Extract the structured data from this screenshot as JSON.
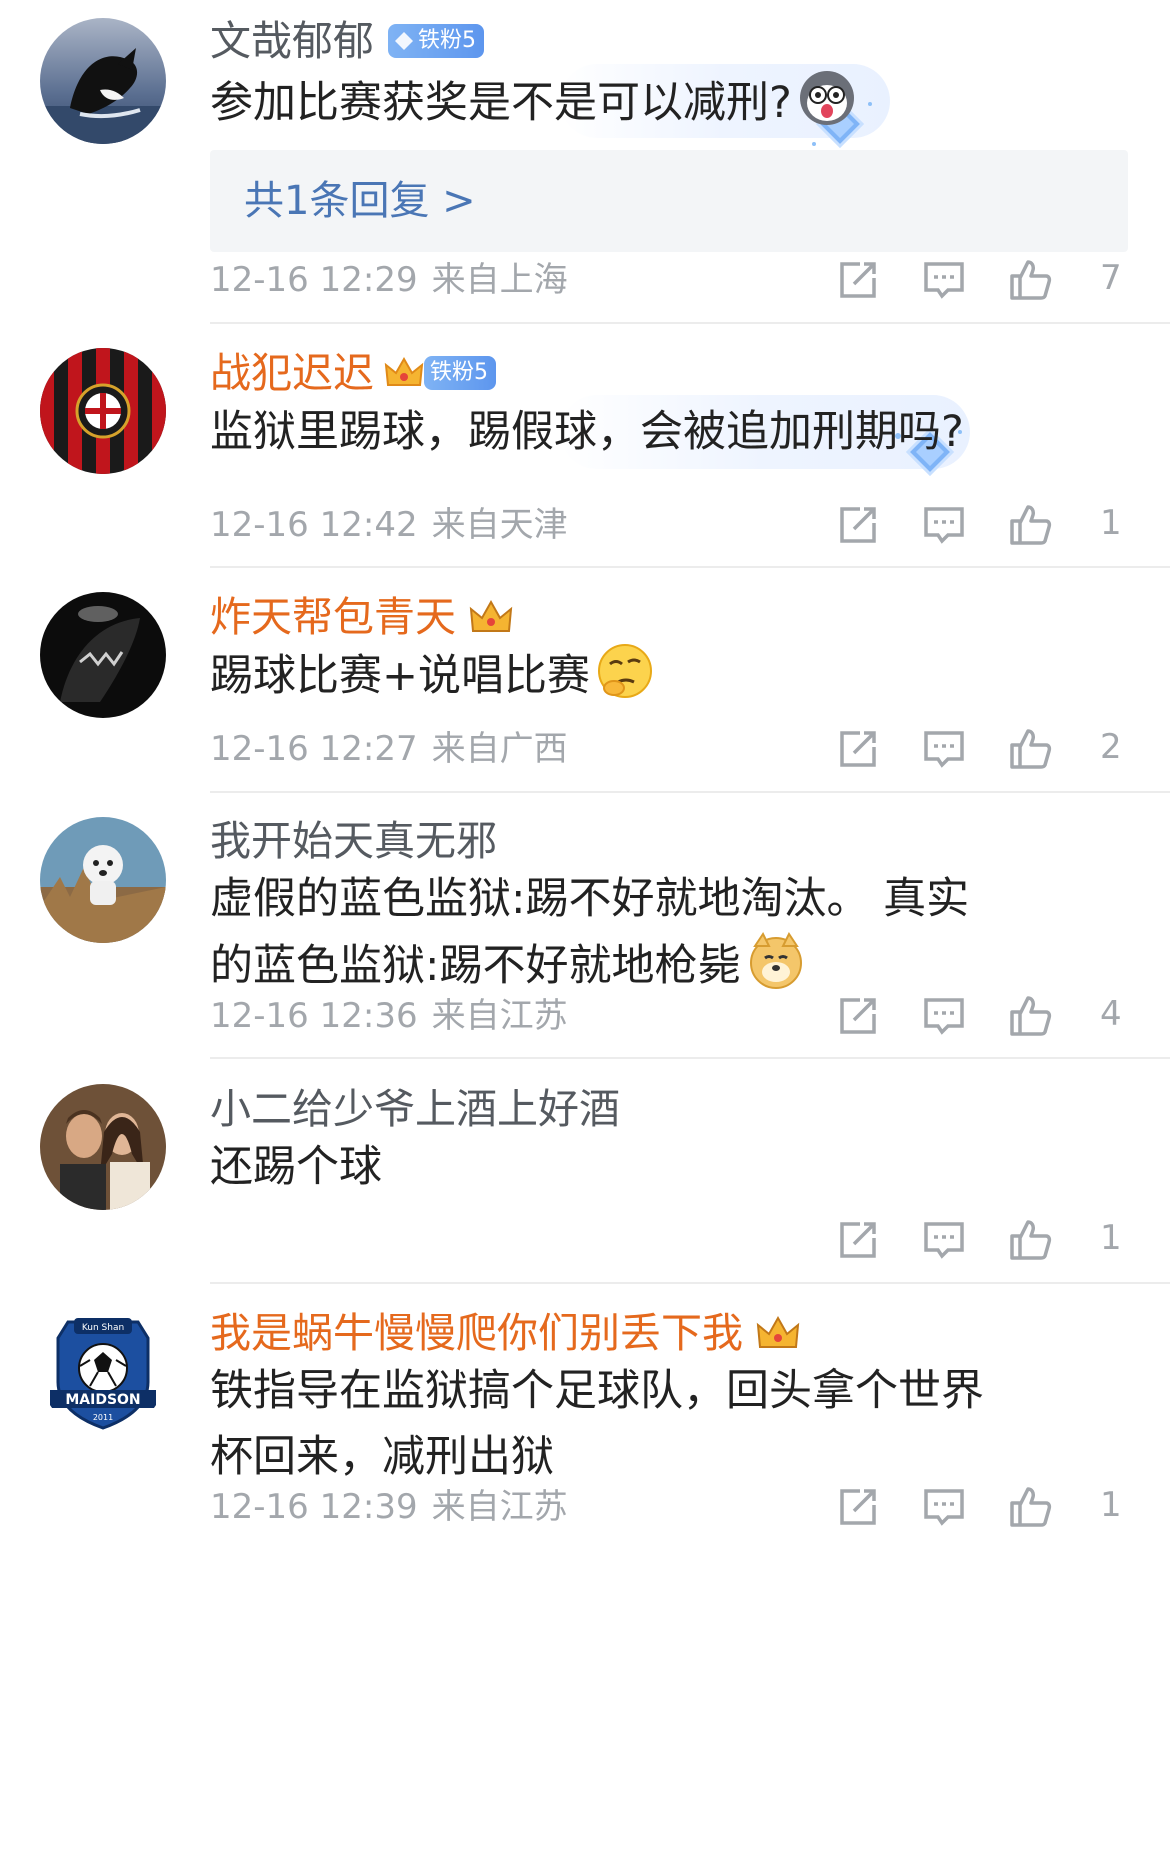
{
  "comments": [
    {
      "username": "文哉郁郁",
      "name_color": "gray",
      "badge": "铁粉5",
      "text": "参加比赛获奖是不是可以减刑?",
      "emoji": "shocked-husky-emoji",
      "reply_link": "共1条回复 >",
      "date": "12-16 12:29",
      "location": "来自上海",
      "likes": "7",
      "avatar": "orca-avatar"
    },
    {
      "username": "战犯迟迟",
      "name_color": "orange",
      "badge": "铁粉5",
      "text": "监狱里踢球，踢假球，会被追加刑期吗?",
      "date": "12-16 12:42",
      "location": "来自天津",
      "likes": "1",
      "avatar": "ac-milan-avatar"
    },
    {
      "username": "炸天帮包青天",
      "name_color": "orange",
      "text": "踢球比赛+说唱比赛",
      "emoji": "thinking-face-emoji",
      "date": "12-16 12:27",
      "location": "来自广西",
      "likes": "2",
      "avatar": "dark-creature-avatar"
    },
    {
      "username": "我开始天真无邪",
      "name_color": "gray",
      "text": "虚假的蓝色监狱:踢不好就地淘汰。 真实的蓝色监狱:踢不好就地枪毙",
      "emoji": "doge-emoji",
      "date": "12-16 12:36",
      "location": "来自江苏",
      "likes": "4",
      "avatar": "dog-city-avatar"
    },
    {
      "username": "小二给少爷上酒上好酒",
      "name_color": "gray",
      "text": "还踢个球",
      "date": "",
      "location": "",
      "likes": "1",
      "avatar": "couple-avatar"
    },
    {
      "username": "我是蜗牛慢慢爬你们别丢下我",
      "name_color": "orange",
      "text": "铁指导在监狱搞个足球队，回头拿个世界杯回来，减刑出狱",
      "date": "12-16 12:39",
      "location": "来自江苏",
      "likes": "1",
      "avatar": "maidson-badge-avatar",
      "avatar_text": {
        "top": "Kun Shan",
        "main": "MAIDSON",
        "year": "2011"
      }
    }
  ],
  "colors": {
    "orange_name": "#e5691d",
    "gray_name": "#555a60",
    "meta": "#a3a7ac",
    "reply_link": "#4a76b5",
    "badge": "#6aa2f0"
  }
}
